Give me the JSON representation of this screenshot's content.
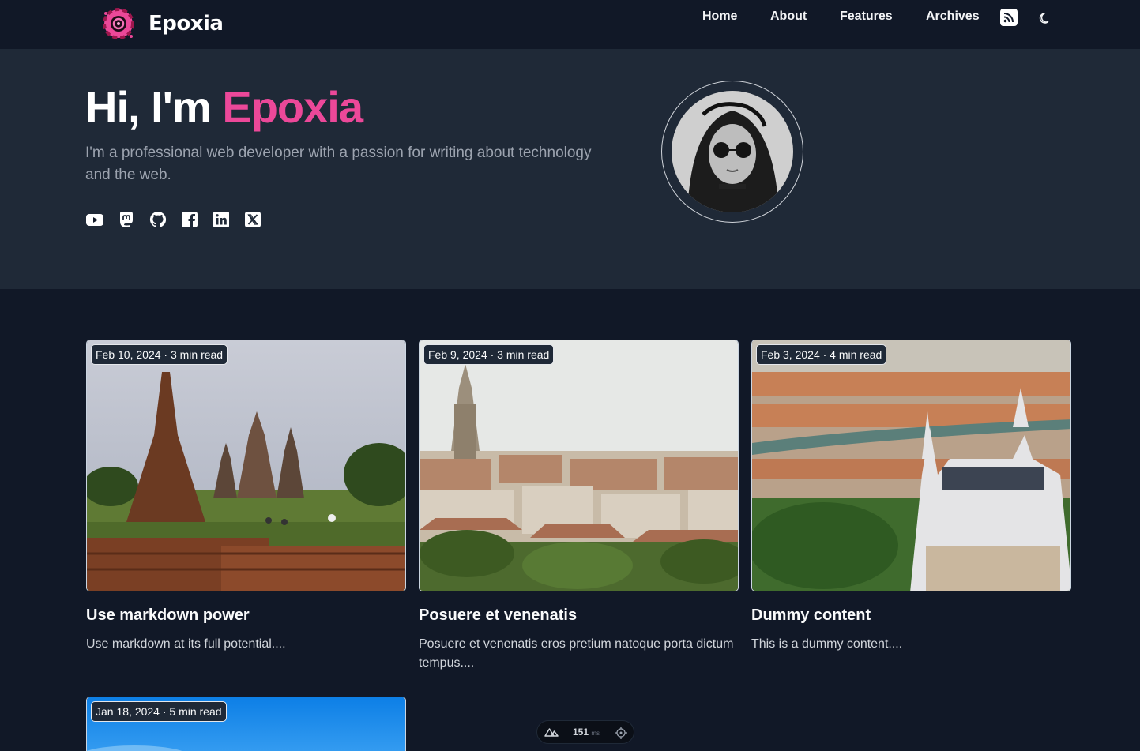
{
  "brand": {
    "name": "Epoxia",
    "accent_color": "#ec4899"
  },
  "nav": {
    "items": [
      {
        "label": "Home"
      },
      {
        "label": "About"
      },
      {
        "label": "Features"
      },
      {
        "label": "Archives"
      }
    ],
    "rss_icon": "rss-icon",
    "theme_icon": "moon-icon"
  },
  "hero": {
    "greeting": "Hi, I'm ",
    "name": "Epoxia",
    "subtitle": "I'm a professional web developer with a passion for writing about technology and the web.",
    "socials": [
      {
        "name": "youtube-icon"
      },
      {
        "name": "mastodon-icon"
      },
      {
        "name": "github-icon"
      },
      {
        "name": "facebook-icon"
      },
      {
        "name": "linkedin-icon"
      },
      {
        "name": "x-icon"
      }
    ]
  },
  "posts": [
    {
      "meta": "Feb 10, 2024 · 3 min read",
      "title": "Use markdown power",
      "excerpt": "Use markdown at its full potential...."
    },
    {
      "meta": "Feb 9, 2024 · 3 min read",
      "title": "Posuere et venenatis",
      "excerpt": "Posuere et venenatis eros pretium natoque porta dictum tempus...."
    },
    {
      "meta": "Feb 3, 2024 · 4 min read",
      "title": "Dummy content",
      "excerpt": "This is a dummy content...."
    },
    {
      "meta": "Jan 18, 2024 · 5 min read",
      "title": "",
      "excerpt": ""
    }
  ],
  "devtools": {
    "time": "151",
    "unit": "ms"
  }
}
